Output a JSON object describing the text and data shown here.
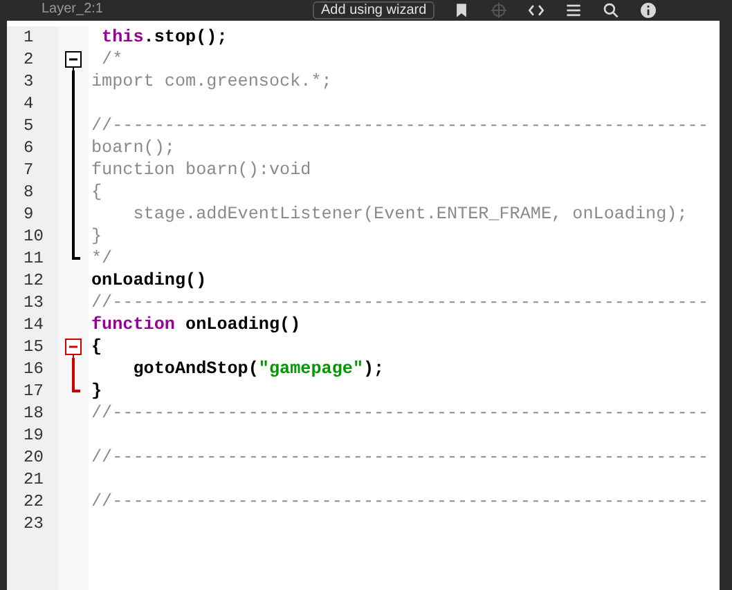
{
  "toolbar": {
    "layer_label": "Layer_2:1",
    "wizard_button": "Add using wizard",
    "icons": [
      {
        "kind": "pin",
        "disabled": false
      },
      {
        "kind": "target",
        "disabled": true
      },
      {
        "kind": "code",
        "disabled": false
      },
      {
        "kind": "lines",
        "disabled": false
      },
      {
        "kind": "search",
        "disabled": false
      },
      {
        "kind": "info",
        "disabled": false
      }
    ]
  },
  "editor": {
    "lines": [
      {
        "number": "1",
        "tokens": [
          {
            "kind": "keyword",
            "text": " this"
          },
          {
            "kind": "code",
            "text": ".stop();"
          }
        ]
      },
      {
        "number": "2",
        "fold": {
          "kind": "open",
          "color": "#000000"
        },
        "tokens": [
          {
            "kind": "comment",
            "text": " /*"
          }
        ]
      },
      {
        "number": "3",
        "fold": {
          "kind": "through",
          "color": "#000000"
        },
        "tokens": [
          {
            "kind": "comment",
            "text": "import com.greensock.*;"
          }
        ]
      },
      {
        "number": "4",
        "fold": {
          "kind": "through",
          "color": "#000000"
        }
      },
      {
        "number": "5",
        "fold": {
          "kind": "through",
          "color": "#000000"
        },
        "tokens": [
          {
            "kind": "comment",
            "text": "//---------------------------------------------------------"
          }
        ]
      },
      {
        "number": "6",
        "fold": {
          "kind": "through",
          "color": "#000000"
        },
        "tokens": [
          {
            "kind": "comment",
            "text": "boarn();"
          }
        ]
      },
      {
        "number": "7",
        "fold": {
          "kind": "through",
          "color": "#000000"
        },
        "tokens": [
          {
            "kind": "comment",
            "text": "function boarn():void"
          }
        ]
      },
      {
        "number": "8",
        "fold": {
          "kind": "through",
          "color": "#000000"
        },
        "tokens": [
          {
            "kind": "comment",
            "text": "{"
          }
        ]
      },
      {
        "number": "9",
        "fold": {
          "kind": "through",
          "color": "#000000"
        },
        "tokens": [
          {
            "kind": "comment",
            "text": "    stage.addEventListener(Event.ENTER_FRAME, onLoading);"
          }
        ]
      },
      {
        "number": "10",
        "fold": {
          "kind": "through",
          "color": "#000000"
        },
        "tokens": [
          {
            "kind": "comment",
            "text": "}"
          }
        ]
      },
      {
        "number": "11",
        "fold": {
          "kind": "close",
          "color": "#000000"
        },
        "tokens": [
          {
            "kind": "comment",
            "text": "*/"
          }
        ]
      },
      {
        "number": "12",
        "tokens": [
          {
            "kind": "code",
            "text": "onLoading()"
          }
        ]
      },
      {
        "number": "13",
        "tokens": [
          {
            "kind": "comment",
            "text": "//---------------------------------------------------------"
          }
        ]
      },
      {
        "number": "14",
        "tokens": [
          {
            "kind": "keyword",
            "text": "function"
          },
          {
            "kind": "code",
            "text": " onLoading()"
          }
        ]
      },
      {
        "number": "15",
        "fold": {
          "kind": "open",
          "color": "#cc0000"
        },
        "tokens": [
          {
            "kind": "code",
            "text": "{"
          }
        ]
      },
      {
        "number": "16",
        "fold": {
          "kind": "through",
          "color": "#cc0000"
        },
        "tokens": [
          {
            "kind": "code",
            "text": "    gotoAndStop("
          },
          {
            "kind": "string",
            "text": "\"gamepage\""
          },
          {
            "kind": "code",
            "text": ");"
          }
        ]
      },
      {
        "number": "17",
        "fold": {
          "kind": "close",
          "color": "#cc0000"
        },
        "tokens": [
          {
            "kind": "code",
            "text": "}"
          }
        ]
      },
      {
        "number": "18",
        "tokens": [
          {
            "kind": "comment",
            "text": "//---------------------------------------------------------"
          }
        ]
      },
      {
        "number": "19"
      },
      {
        "number": "20",
        "tokens": [
          {
            "kind": "comment",
            "text": "//---------------------------------------------------------"
          }
        ]
      },
      {
        "number": "21"
      },
      {
        "number": "22",
        "tokens": [
          {
            "kind": "comment",
            "text": "//---------------------------------------------------------"
          }
        ]
      },
      {
        "number": "23"
      }
    ]
  }
}
